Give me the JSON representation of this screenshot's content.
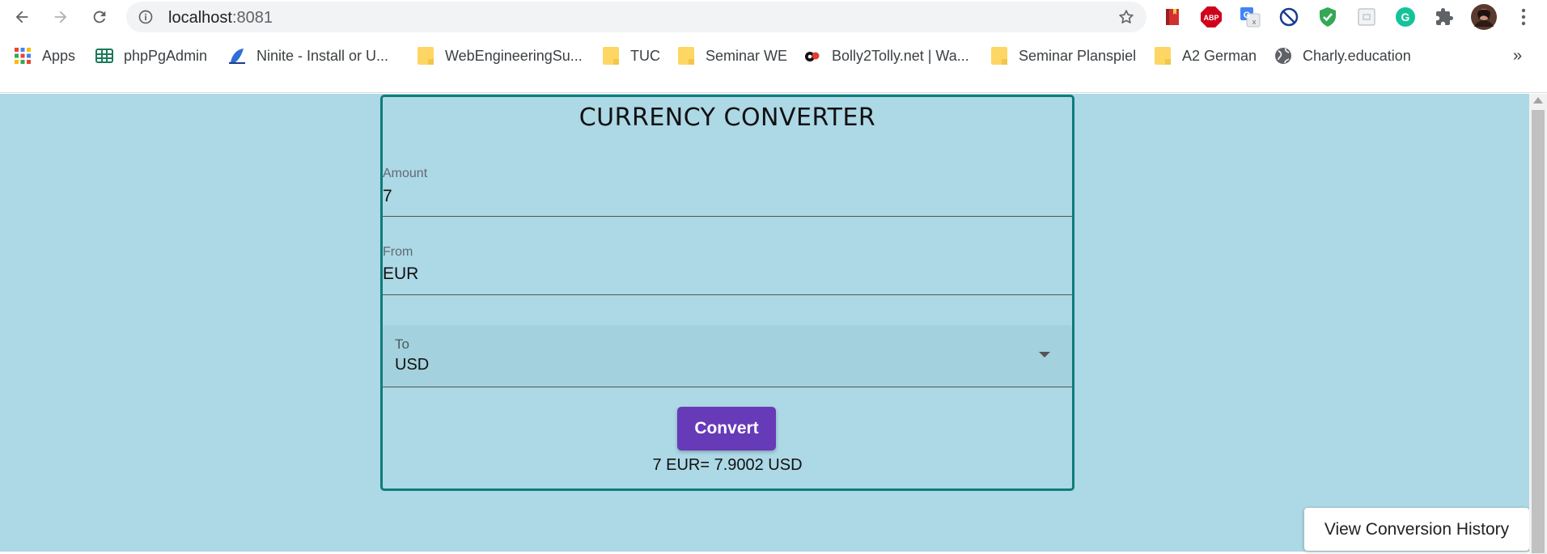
{
  "browser": {
    "url_host": "localhost",
    "url_port": ":8081",
    "bookmarks_overflow": "»",
    "bookmarks": [
      {
        "label": "Apps",
        "icon": "apps-grid-icon"
      },
      {
        "label": "phpPgAdmin",
        "icon": "phppgadmin-icon"
      },
      {
        "label": "Ninite - Install or U...",
        "icon": "ninite-icon"
      },
      {
        "label": "WebEngineeringSu...",
        "icon": "folder-icon"
      },
      {
        "label": "TUC",
        "icon": "folder-icon"
      },
      {
        "label": "Seminar WE",
        "icon": "folder-icon"
      },
      {
        "label": "Bolly2Tolly.net | Wa...",
        "icon": "bolly2tolly-icon"
      },
      {
        "label": "Seminar Planspiel",
        "icon": "folder-icon"
      },
      {
        "label": "A2 German",
        "icon": "folder-icon"
      },
      {
        "label": "Charly.education",
        "icon": "globe-icon"
      }
    ],
    "extensions": [
      "bookmark-ext-icon",
      "adblock-icon",
      "google-translate-icon",
      "blocker-icon",
      "shield-check-icon",
      "square-ext-icon",
      "grammarly-icon",
      "puzzle-icon",
      "profile-avatar",
      "kebab-menu-icon"
    ],
    "adblock_label": "ABP"
  },
  "app": {
    "title": "CURRENCY CONVERTER",
    "amount": {
      "label": "Amount",
      "value": "7"
    },
    "from": {
      "label": "From",
      "value": "EUR"
    },
    "to": {
      "label": "To",
      "value": "USD"
    },
    "convert_label": "Convert",
    "result": "7 EUR= 7.9002 USD",
    "history_label": "View Conversion History"
  },
  "colors": {
    "page_background": "#add8e6",
    "card_border": "#0e7c7b",
    "button_primary": "#673ab7",
    "select_fill": "#a3d1dd"
  }
}
